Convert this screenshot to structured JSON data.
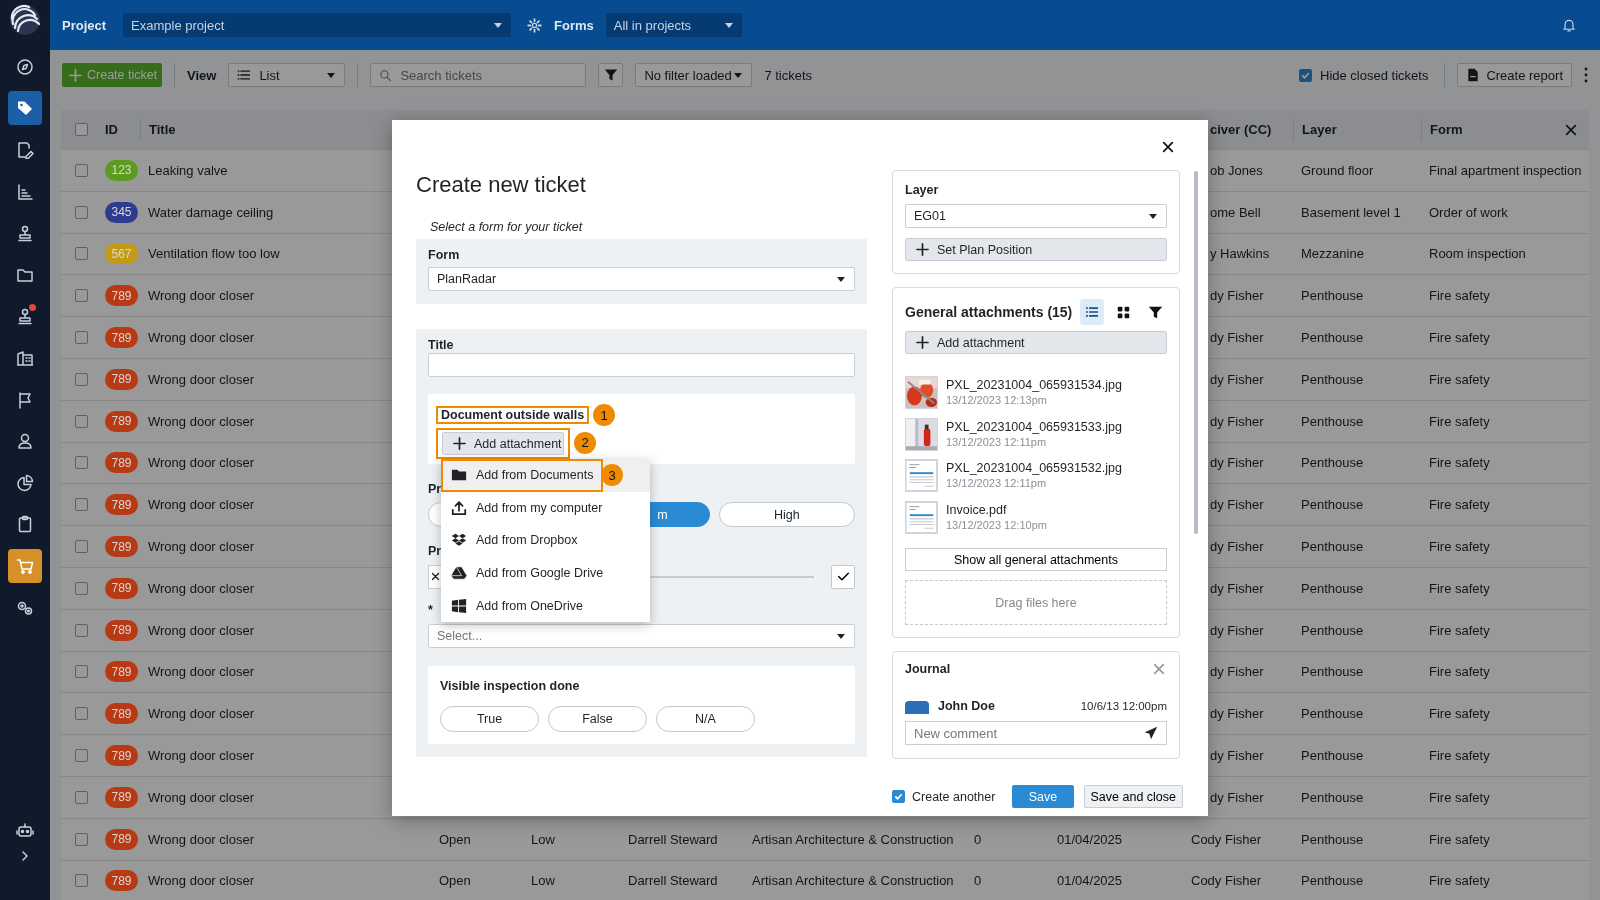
{
  "sidebar": {
    "items": [
      {
        "selected": false,
        "highlighted": false,
        "notification": false
      },
      {
        "selected": true,
        "highlighted": false,
        "notification": false
      },
      {
        "selected": false,
        "highlighted": false,
        "notification": false
      },
      {
        "selected": false,
        "highlighted": false,
        "notification": false
      },
      {
        "selected": false,
        "highlighted": false,
        "notification": false
      },
      {
        "selected": false,
        "highlighted": false,
        "notification": false
      },
      {
        "selected": false,
        "highlighted": false,
        "notification": true
      },
      {
        "selected": false,
        "highlighted": false,
        "notification": false
      },
      {
        "selected": false,
        "highlighted": false,
        "notification": false
      },
      {
        "selected": false,
        "highlighted": false,
        "notification": false
      },
      {
        "selected": false,
        "highlighted": false,
        "notification": false
      },
      {
        "selected": false,
        "highlighted": false,
        "notification": false
      },
      {
        "selected": false,
        "highlighted": true,
        "notification": false
      },
      {
        "selected": false,
        "highlighted": false,
        "notification": false
      }
    ]
  },
  "topbar": {
    "project_label": "Project",
    "project": "Example project",
    "forms_label": "Forms",
    "forms": "All in projects"
  },
  "toolbar": {
    "create_button": "Create ticket",
    "view_label": "View",
    "view": "List",
    "search_placeholder": "Search tickets",
    "filter": "No filter loaded",
    "count": "7 tickets",
    "hide_closed": {
      "label": "Hide closed tickets",
      "checked": true
    },
    "report_button": "Create report"
  },
  "table": {
    "all_checked": false,
    "columns": [
      "ID",
      "Title",
      "civer (CC)",
      "Layer",
      "Form"
    ],
    "rows": [
      {
        "kind": "covered",
        "checked": false,
        "id": "123",
        "color": "#5c9b1f",
        "title": "Leaking valve",
        "receiver": "ob Jones",
        "layer": "Ground floor",
        "form": "Final apartment inspection"
      },
      {
        "kind": "covered",
        "checked": false,
        "id": "345",
        "color": "#2e3c8f",
        "title": "Water damage ceiling",
        "receiver": "ome Bell",
        "layer": "Basement level 1",
        "form": "Order of work"
      },
      {
        "kind": "covered",
        "checked": false,
        "id": "567",
        "color": "#c29a16",
        "title": "Ventilation flow too low",
        "receiver": "y Hawkins",
        "layer": "Mezzanine",
        "form": "Room inspection"
      },
      {
        "kind": "covered",
        "checked": false,
        "id": "789",
        "color": "#b83a14",
        "title": "Wrong door closer",
        "receiver": "dy Fisher",
        "layer": "Penthouse",
        "form": "Fire safety"
      },
      {
        "kind": "covered",
        "checked": false,
        "id": "789",
        "color": "#b83a14",
        "title": "Wrong door closer",
        "receiver": "dy Fisher",
        "layer": "Penthouse",
        "form": "Fire safety"
      },
      {
        "kind": "covered",
        "checked": false,
        "id": "789",
        "color": "#b83a14",
        "title": "Wrong door closer",
        "receiver": "dy Fisher",
        "layer": "Penthouse",
        "form": "Fire safety"
      },
      {
        "kind": "covered",
        "checked": false,
        "id": "789",
        "color": "#b83a14",
        "title": "Wrong door closer",
        "receiver": "dy Fisher",
        "layer": "Penthouse",
        "form": "Fire safety"
      },
      {
        "kind": "covered",
        "checked": false,
        "id": "789",
        "color": "#b83a14",
        "title": "Wrong door closer",
        "receiver": "dy Fisher",
        "layer": "Penthouse",
        "form": "Fire safety"
      },
      {
        "kind": "covered",
        "checked": false,
        "id": "789",
        "color": "#b83a14",
        "title": "Wrong door closer",
        "receiver": "dy Fisher",
        "layer": "Penthouse",
        "form": "Fire safety"
      },
      {
        "kind": "covered",
        "checked": false,
        "id": "789",
        "color": "#b83a14",
        "title": "Wrong door closer",
        "receiver": "dy Fisher",
        "layer": "Penthouse",
        "form": "Fire safety"
      },
      {
        "kind": "covered",
        "checked": false,
        "id": "789",
        "color": "#b83a14",
        "title": "Wrong door closer",
        "receiver": "dy Fisher",
        "layer": "Penthouse",
        "form": "Fire safety"
      },
      {
        "kind": "covered",
        "checked": false,
        "id": "789",
        "color": "#b83a14",
        "title": "Wrong door closer",
        "receiver": "dy Fisher",
        "layer": "Penthouse",
        "form": "Fire safety"
      },
      {
        "kind": "covered",
        "checked": false,
        "id": "789",
        "color": "#b83a14",
        "title": "Wrong door closer",
        "receiver": "dy Fisher",
        "layer": "Penthouse",
        "form": "Fire safety"
      },
      {
        "kind": "covered",
        "checked": false,
        "id": "789",
        "color": "#b83a14",
        "title": "Wrong door closer",
        "receiver": "dy Fisher",
        "layer": "Penthouse",
        "form": "Fire safety"
      },
      {
        "kind": "covered",
        "checked": false,
        "id": "789",
        "color": "#b83a14",
        "title": "Wrong door closer",
        "receiver": "dy Fisher",
        "layer": "Penthouse",
        "form": "Fire safety"
      },
      {
        "kind": "covered",
        "checked": false,
        "id": "789",
        "color": "#b83a14",
        "title": "Wrong door closer",
        "receiver": "dy Fisher",
        "layer": "Penthouse",
        "form": "Fire safety"
      },
      {
        "kind": "full",
        "checked": false,
        "id": "789",
        "color": "#b83a14",
        "title": "Wrong door closer",
        "status": "Open",
        "priority": "Low",
        "assignee": "Darrell Steward",
        "company": "Artisan Architecture & Construction",
        "count": "0",
        "date": "01/04/2025",
        "receiver": "Cody Fisher",
        "layer": "Penthouse",
        "form": "Fire safety"
      },
      {
        "kind": "full",
        "checked": false,
        "id": "789",
        "color": "#b83a14",
        "title": "Wrong door closer",
        "status": "Open",
        "priority": "Low",
        "assignee": "Darrell Steward",
        "company": "Artisan Architecture & Construction",
        "count": "0",
        "date": "01/04/2025",
        "receiver": "Cody Fisher",
        "layer": "Penthouse",
        "form": "Fire safety"
      }
    ]
  },
  "modal": {
    "title": "Create new ticket",
    "form_hint": "Select a form for your ticket",
    "form": {
      "label": "Form",
      "value": "PlanRadar"
    },
    "title_field": {
      "label": "Title"
    },
    "document_field": {
      "label": "Document outside walls",
      "label_marker": "1",
      "button": "Add attachment",
      "button_marker": "2"
    },
    "attachment_menu": [
      {
        "kind": "folder",
        "label": "Add from Documents",
        "selected": true,
        "marker": "3"
      },
      {
        "kind": "upload",
        "label": "Add from my computer",
        "selected": false
      },
      {
        "kind": "dropbox",
        "label": "Add from Dropbox",
        "selected": false
      },
      {
        "kind": "drive",
        "label": "Add from Google Drive",
        "selected": false
      },
      {
        "kind": "windows",
        "label": "Add from OneDrive",
        "selected": false
      }
    ],
    "priority": {
      "label": "Pr",
      "options": [
        {
          "selected": false
        },
        {
          "label": "m",
          "selected": true
        },
        {
          "label": "High",
          "selected": false
        }
      ]
    },
    "progress": {
      "label": "Pr"
    },
    "assignee": {
      "label": "*",
      "placeholder": "Select..."
    },
    "inspection": {
      "label": "Visible inspection done",
      "options": [
        {
          "label": "True",
          "selected": false
        },
        {
          "label": "False",
          "selected": false
        },
        {
          "label": "N/A",
          "selected": false
        }
      ]
    },
    "layer": {
      "label": "Layer",
      "value": "EG01",
      "button": "Set Plan Position"
    },
    "attachments": {
      "title": "General attachments (15)",
      "views": [
        {
          "kind": "list",
          "selected": true
        },
        {
          "kind": "grid",
          "selected": false
        }
      ],
      "add_button": "Add attachment",
      "files": [
        {
          "name": "PXL_20231004_065931534.jpg",
          "date": "13/12/2023 12:13pm"
        },
        {
          "name": "PXL_20231004_065931533.jpg",
          "date": "13/12/2023 12:11pm"
        },
        {
          "kind": "document",
          "name": "PXL_20231004_065931532.jpg",
          "date": "13/12/2023 12:11pm"
        },
        {
          "kind": "document",
          "name": "Invoice.pdf",
          "date": "13/12/2023 12:10pm"
        }
      ],
      "show_all": "Show all general attachments",
      "drop_hint": "Drag files here"
    },
    "journal": {
      "title": "Journal",
      "entries": [
        {
          "author": "John Doe",
          "time": "10/6/13 12:00pm"
        }
      ],
      "placeholder": "New comment"
    },
    "create_another": {
      "label": "Create another",
      "checked": true
    },
    "save": "Save",
    "save_close": "Save and close"
  }
}
